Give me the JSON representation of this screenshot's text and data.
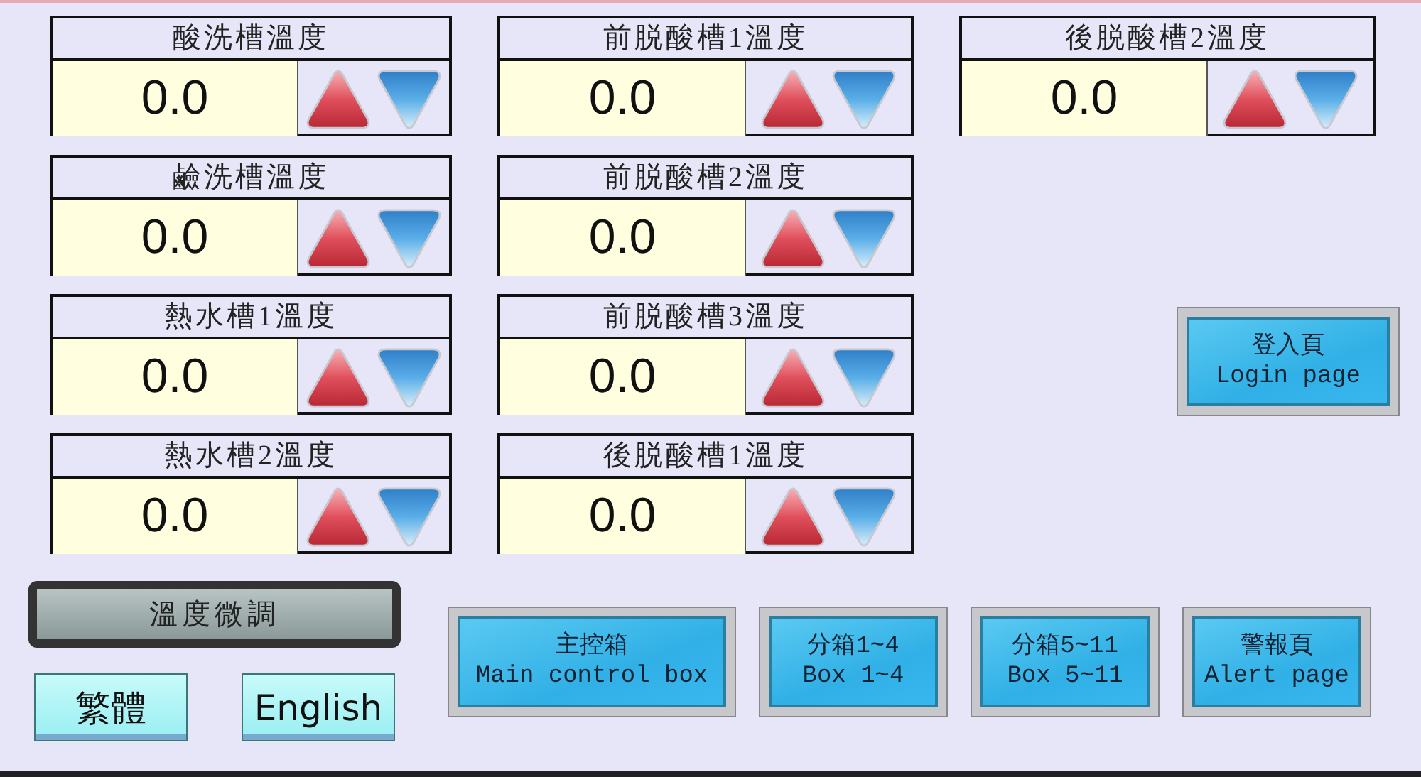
{
  "columns": [
    {
      "panels": [
        {
          "title": "酸洗槽溫度",
          "value": "0.0"
        },
        {
          "title": "鹼洗槽溫度",
          "value": "0.0"
        },
        {
          "title": "熱水槽1溫度",
          "value": "0.0"
        },
        {
          "title": "熱水槽2溫度",
          "value": "0.0"
        }
      ]
    },
    {
      "panels": [
        {
          "title": "前脱酸槽1溫度",
          "value": "0.0"
        },
        {
          "title": "前脱酸槽2溫度",
          "value": "0.0"
        },
        {
          "title": "前脱酸槽3溫度",
          "value": "0.0"
        },
        {
          "title": "後脱酸槽1溫度",
          "value": "0.0"
        }
      ]
    },
    {
      "panels": [
        {
          "title": "後脱酸槽2溫度",
          "value": "0.0"
        }
      ]
    }
  ],
  "login_button": {
    "lines": [
      "登入頁",
      "Login page"
    ]
  },
  "fine_tune_button": {
    "label": "溫度微調"
  },
  "language_buttons": [
    {
      "label": "繁體"
    },
    {
      "label": "English"
    }
  ],
  "nav_buttons": [
    {
      "lines": [
        "主控箱",
        "Main control box"
      ]
    },
    {
      "lines": [
        "分箱1~4",
        "Box 1~4"
      ]
    },
    {
      "lines": [
        "分箱5~11",
        "Box 5~11"
      ]
    },
    {
      "lines": [
        "警報頁",
        "Alert page"
      ]
    }
  ]
}
